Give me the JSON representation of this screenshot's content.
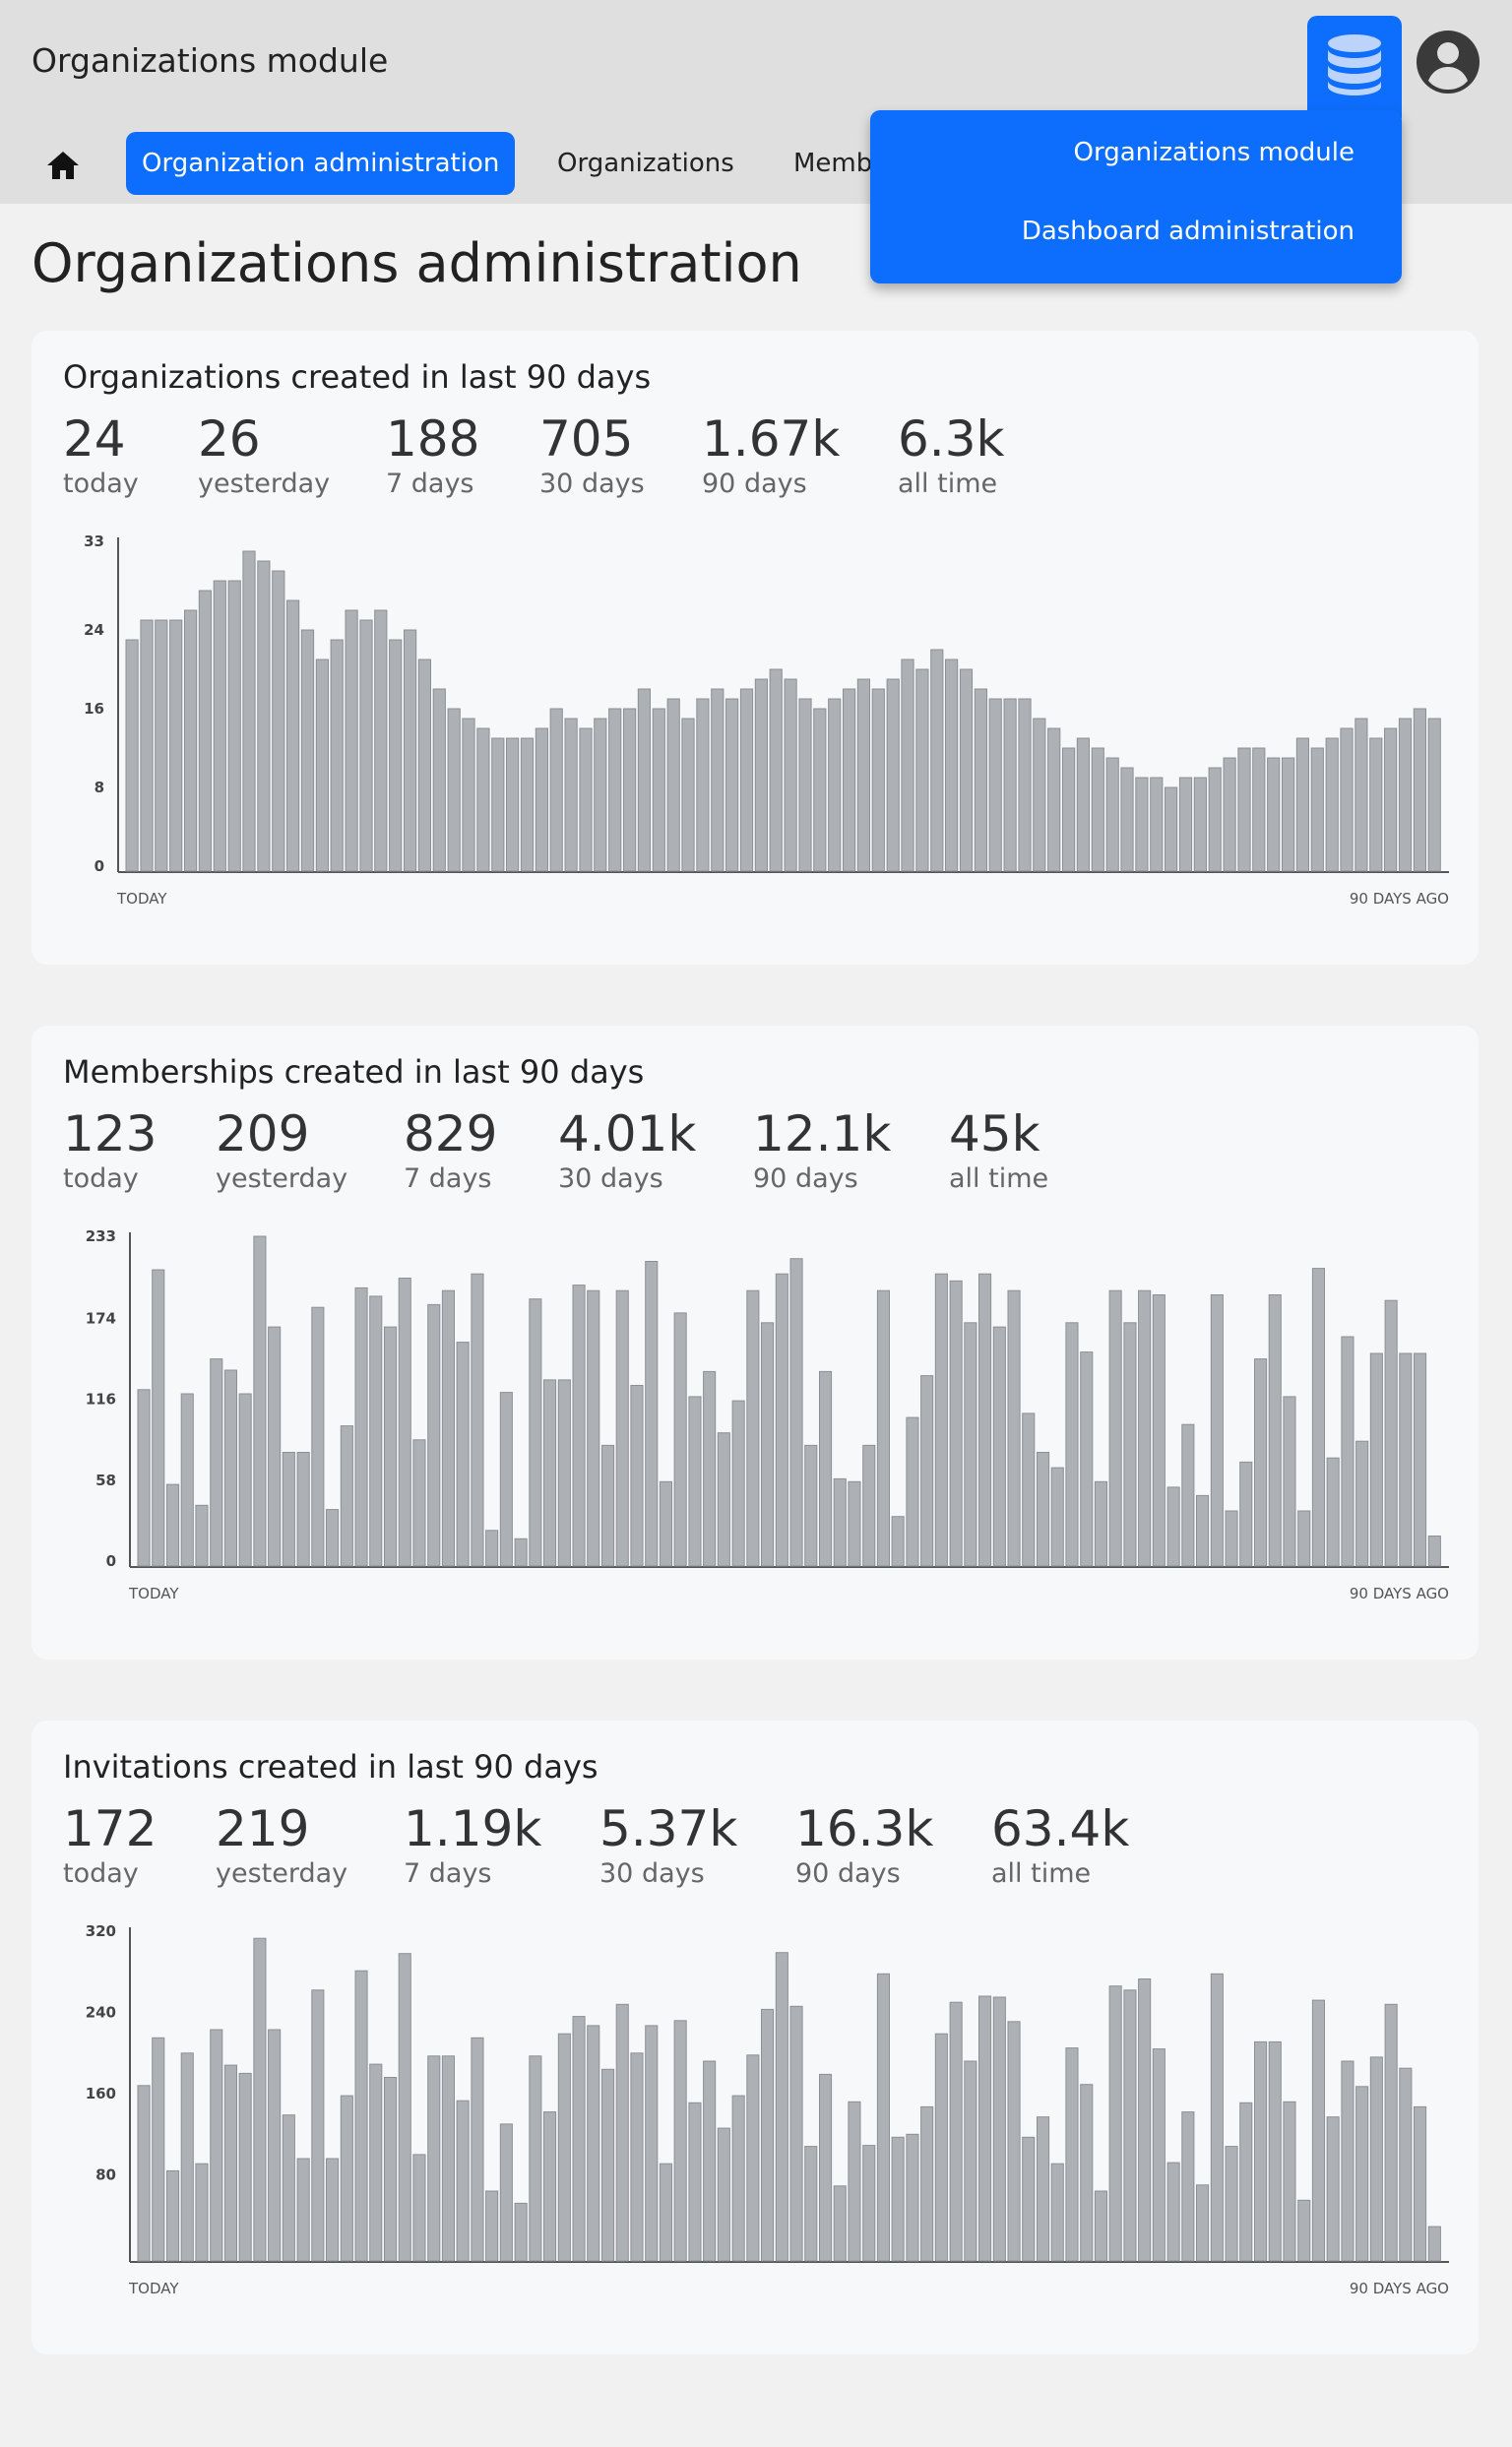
{
  "header": {
    "app_title": "Organizations module",
    "db_icon": "database-icon",
    "user_icon": "account-circle-icon"
  },
  "nav": {
    "home_icon": "home-icon",
    "tabs": [
      {
        "label": "Organization administration",
        "active": true
      },
      {
        "label": "Organizations",
        "active": false
      },
      {
        "label": "Memberships",
        "active": false
      }
    ]
  },
  "dropdown": {
    "items": [
      "Organizations module",
      "Dashboard administration"
    ]
  },
  "page": {
    "title": "Organizations administration"
  },
  "cards": [
    {
      "title": "Organizations created in last 90 days",
      "stats": [
        {
          "value": "24",
          "label": "today"
        },
        {
          "value": "26",
          "label": "yesterday"
        },
        {
          "value": "188",
          "label": "7 days"
        },
        {
          "value": "705",
          "label": "30 days"
        },
        {
          "value": "1.67k",
          "label": "90 days"
        },
        {
          "value": "6.3k",
          "label": "all time"
        }
      ]
    },
    {
      "title": "Memberships created in last 90 days",
      "stats": [
        {
          "value": "123",
          "label": "today"
        },
        {
          "value": "209",
          "label": "yesterday"
        },
        {
          "value": "829",
          "label": "7 days"
        },
        {
          "value": "4.01k",
          "label": "30 days"
        },
        {
          "value": "12.1k",
          "label": "90 days"
        },
        {
          "value": "45k",
          "label": "all time"
        }
      ]
    },
    {
      "title": "Invitations created in last 90 days",
      "stats": [
        {
          "value": "172",
          "label": "today"
        },
        {
          "value": "219",
          "label": "yesterday"
        },
        {
          "value": "1.19k",
          "label": "7 days"
        },
        {
          "value": "5.37k",
          "label": "30 days"
        },
        {
          "value": "16.3k",
          "label": "90 days"
        },
        {
          "value": "63.4k",
          "label": "all time"
        }
      ]
    }
  ],
  "colors": {
    "accent": "#0d6efd",
    "bar": "#adb1b5",
    "bar_stroke": "#8c9095"
  },
  "chart_data": [
    {
      "type": "bar",
      "title": "Organizations created in last 90 days",
      "x_start_label": "TODAY",
      "x_end_label": "90 DAYS AGO",
      "yticks": [
        0,
        8,
        16,
        24,
        33
      ],
      "ylim": [
        0,
        33
      ],
      "values": [
        23,
        25,
        25,
        25,
        26,
        28,
        29,
        29,
        32,
        31,
        30,
        27,
        24,
        21,
        23,
        26,
        25,
        26,
        23,
        24,
        21,
        18,
        16,
        15,
        14,
        13,
        13,
        13,
        14,
        16,
        15,
        14,
        15,
        16,
        16,
        18,
        16,
        17,
        15,
        17,
        18,
        17,
        18,
        19,
        20,
        19,
        17,
        16,
        17,
        18,
        19,
        18,
        19,
        21,
        20,
        22,
        21,
        20,
        18,
        17,
        17,
        17,
        15,
        14,
        12,
        13,
        12,
        11,
        10,
        9,
        9,
        8,
        9,
        9,
        10,
        11,
        12,
        12,
        11,
        11,
        13,
        12,
        13,
        14,
        15,
        13,
        14,
        15,
        16,
        15
      ]
    },
    {
      "type": "bar",
      "title": "Memberships created in last 90 days",
      "x_start_label": "TODAY",
      "x_end_label": "90 DAYS AGO",
      "yticks": [
        0,
        58,
        116,
        174,
        233
      ],
      "ylim": [
        0,
        233
      ],
      "values": [
        123,
        209,
        55,
        120,
        40,
        145,
        137,
        120,
        233,
        168,
        78,
        78,
        182,
        37,
        97,
        196,
        190,
        168,
        203,
        87,
        184,
        194,
        157,
        206,
        22,
        121,
        16,
        188,
        130,
        130,
        198,
        194,
        83,
        194,
        126,
        215,
        57,
        178,
        118,
        136,
        92,
        115,
        194,
        171,
        206,
        217,
        83,
        136,
        59,
        57,
        83,
        194,
        32,
        103,
        133,
        206,
        201,
        171,
        206,
        168,
        194,
        106,
        78,
        67,
        171,
        150,
        57,
        194,
        171,
        194,
        191,
        53,
        98,
        47,
        191,
        36,
        71,
        145,
        191,
        118,
        36,
        210,
        74,
        161,
        86,
        149,
        187,
        149,
        149,
        18
      ]
    },
    {
      "type": "bar",
      "title": "Invitations created in last 90 days",
      "x_start_label": "TODAY",
      "x_end_label": "90 DAYS AGO",
      "yticks": [
        80,
        160,
        240,
        320
      ],
      "ylim": [
        0,
        320
      ],
      "values": [
        168,
        215,
        84,
        200,
        91,
        223,
        188,
        180,
        313,
        223,
        139,
        96,
        262,
        96,
        158,
        281,
        189,
        176,
        298,
        100,
        197,
        197,
        153,
        215,
        64,
        130,
        52,
        197,
        142,
        219,
        236,
        227,
        184,
        248,
        200,
        227,
        91,
        232,
        151,
        192,
        126,
        158,
        198,
        243,
        299,
        246,
        108,
        179,
        69,
        152,
        109,
        278,
        117,
        120,
        147,
        219,
        250,
        192,
        256,
        255,
        231,
        117,
        137,
        91,
        205,
        169,
        64,
        266,
        262,
        273,
        204,
        92,
        142,
        70,
        278,
        108,
        151,
        211,
        211,
        152,
        55,
        252,
        137,
        192,
        167,
        196,
        248,
        185,
        147,
        29
      ]
    }
  ]
}
